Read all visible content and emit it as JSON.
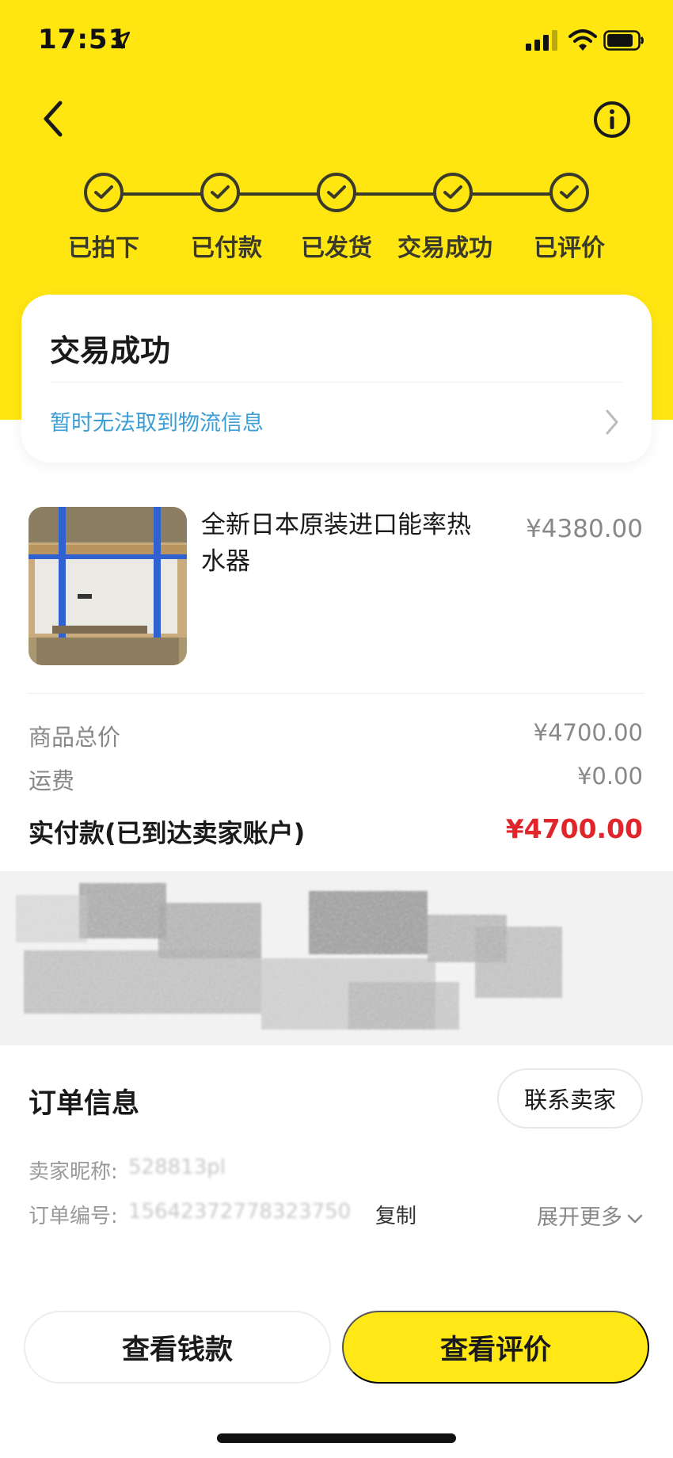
{
  "status_bar": {
    "time": "17:51"
  },
  "steps": [
    {
      "label": "已拍下"
    },
    {
      "label": "已付款"
    },
    {
      "label": "已发货"
    },
    {
      "label": "交易成功"
    },
    {
      "label": "已评价"
    }
  ],
  "status_card": {
    "title": "交易成功",
    "logistics": "暂时无法取到物流信息"
  },
  "product": {
    "title": "全新日本原装进口能率热水器",
    "price": "¥4380.00"
  },
  "summary": {
    "total_label": "商品总价",
    "total_value": "¥4700.00",
    "shipping_label": "运费",
    "shipping_value": "¥0.00",
    "paid_label": "实付款(已到达卖家账户)",
    "paid_value": "¥4700.00"
  },
  "order_info": {
    "title": "订单信息",
    "contact_label": "联系卖家",
    "seller_label": "卖家昵称:",
    "seller_value": "528813pl",
    "order_no_label": "订单编号:",
    "order_no_value": "15642372778323750",
    "copy_label": "复制",
    "expand_label": "展开更多"
  },
  "buttons": {
    "money_label": "查看钱款",
    "review_label": "查看评价"
  },
  "colors": {
    "brand_yellow": "#ffe611",
    "price_red": "#e0262b",
    "link_blue": "#3b9ed6"
  }
}
